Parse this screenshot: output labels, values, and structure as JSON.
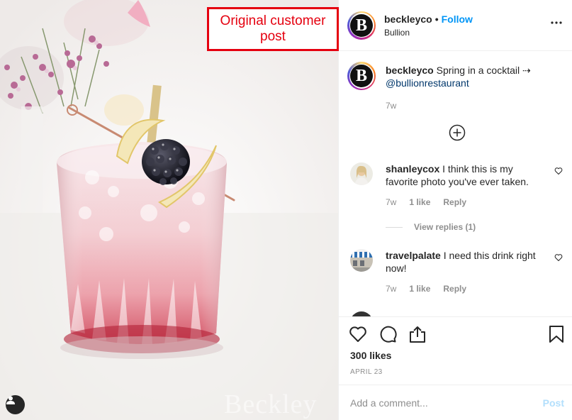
{
  "annotation": {
    "text": "Original customer post"
  },
  "photo": {
    "watermark": "Beckley"
  },
  "header": {
    "username": "beckleyco",
    "separator": "•",
    "follow_label": "Follow",
    "location": "Bullion",
    "avatar_letter": "B"
  },
  "caption": {
    "username": "beckleyco",
    "text": "Spring in a cocktail ⇢",
    "mention": "@bullionrestaurant",
    "time": "7w"
  },
  "comments": [
    {
      "username": "shanleycox",
      "text": "I think this is my favorite photo you've ever taken.",
      "time": "7w",
      "likes": "1 like",
      "reply_label": "Reply",
      "view_replies": "View replies (1)"
    },
    {
      "username": "travelpalate",
      "text": "I need this drink right now!",
      "time": "7w",
      "likes": "1 like",
      "reply_label": "Reply"
    }
  ],
  "actions": {
    "icons": [
      "heart-icon",
      "comment-icon",
      "share-icon",
      "bookmark-icon"
    ],
    "likes": "300 likes",
    "date": "APRIL 23"
  },
  "comment_box": {
    "placeholder": "Add a comment...",
    "post_label": "Post"
  },
  "colors": {
    "link_blue": "#0095f6",
    "mention_blue": "#00376b",
    "muted": "#8e8e8e",
    "annotation_red": "#e5000f",
    "post_disabled": "#b2dffc"
  }
}
